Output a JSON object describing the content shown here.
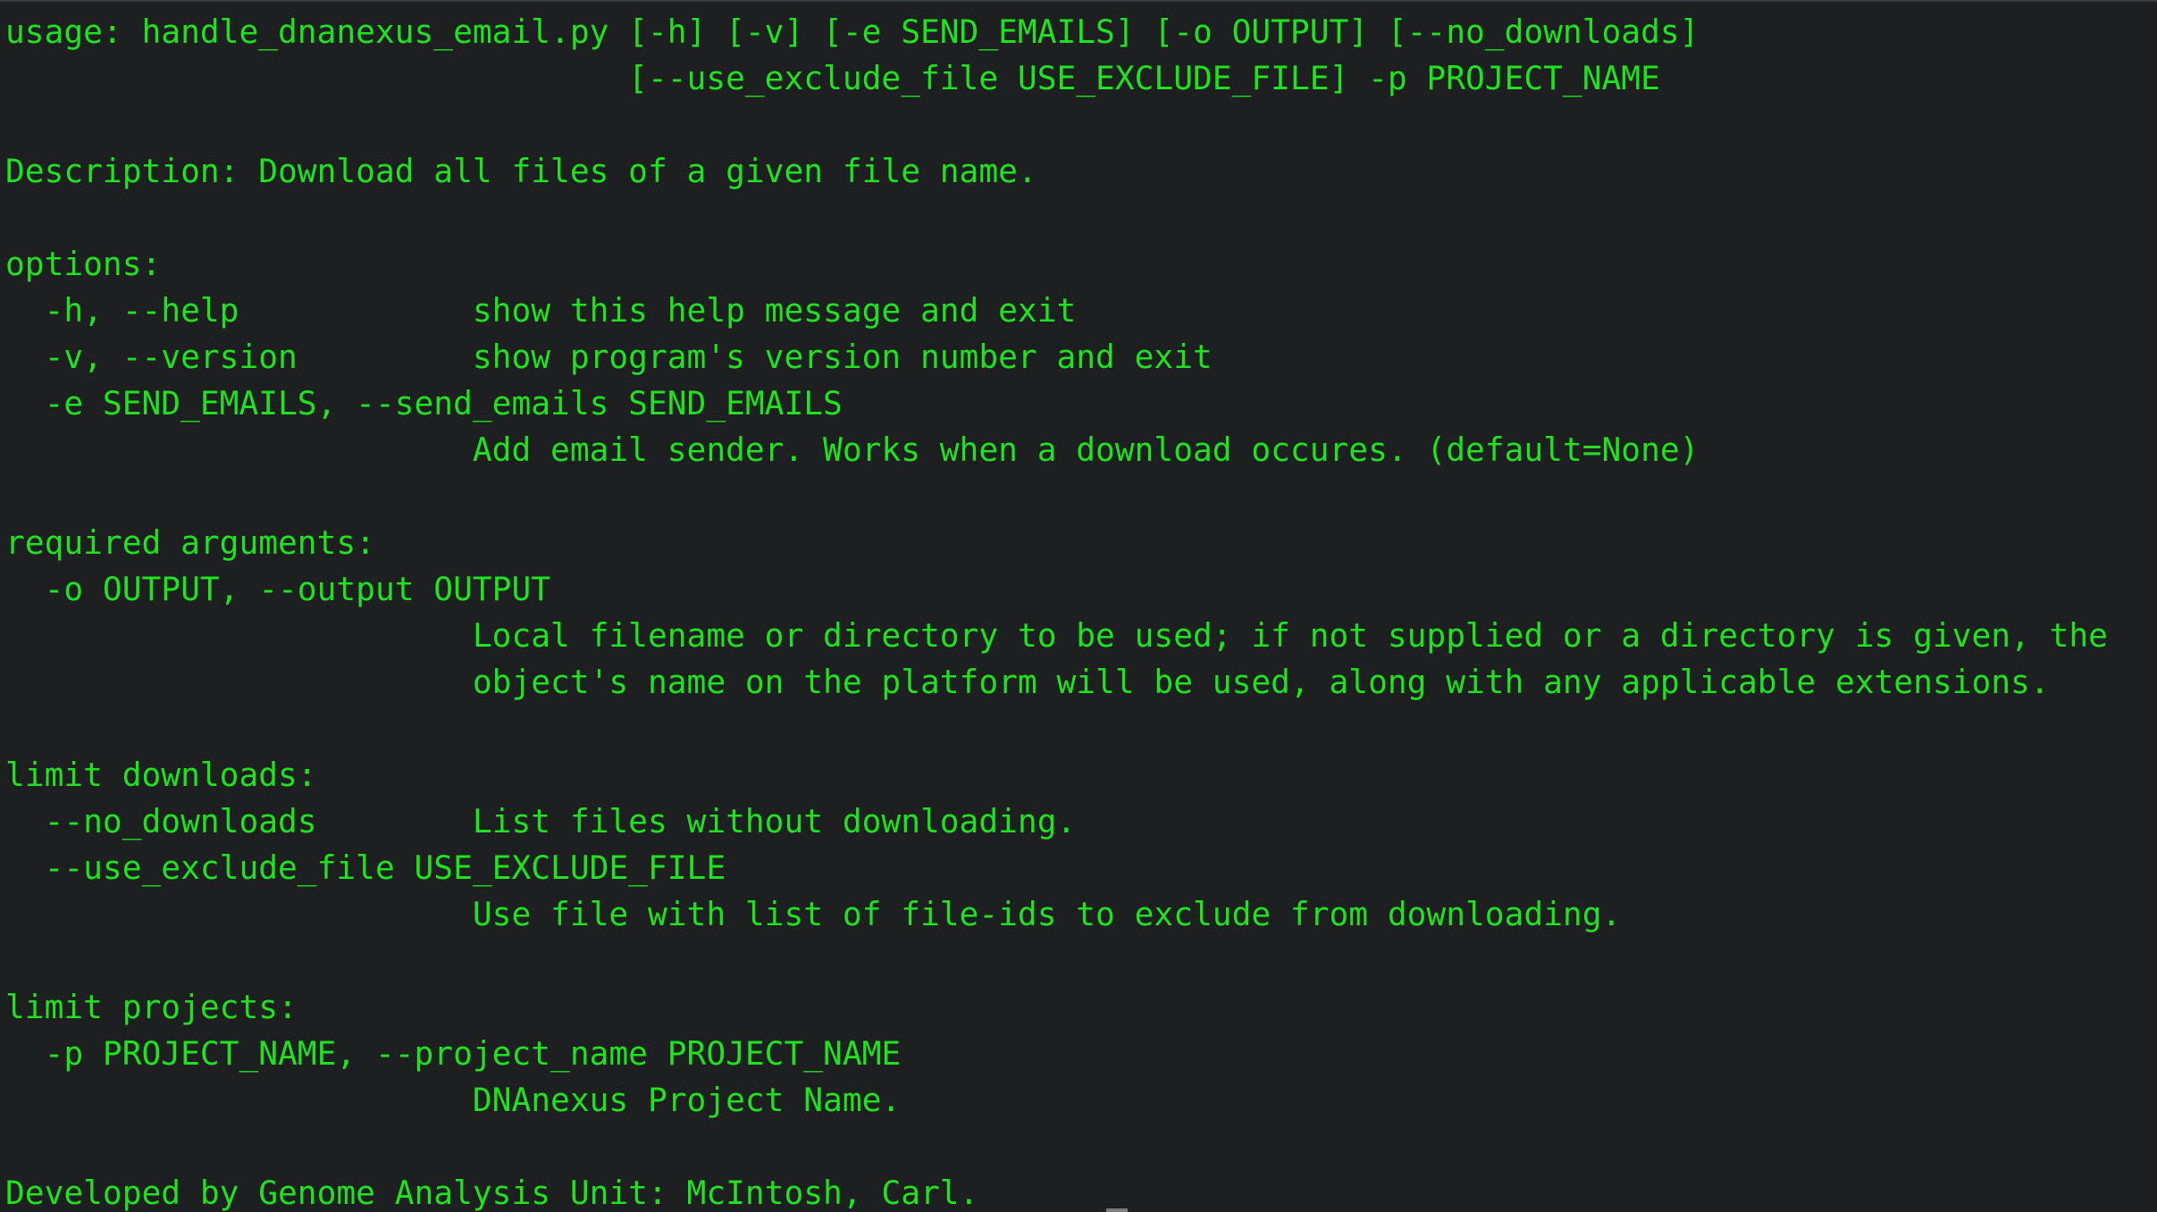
{
  "terminal": {
    "lines": [
      "usage: handle_dnanexus_email.py [-h] [-v] [-e SEND_EMAILS] [-o OUTPUT] [--no_downloads]",
      "                                [--use_exclude_file USE_EXCLUDE_FILE] -p PROJECT_NAME",
      "",
      "Description: Download all files of a given file name.",
      "",
      "options:",
      "  -h, --help            show this help message and exit",
      "  -v, --version         show program's version number and exit",
      "  -e SEND_EMAILS, --send_emails SEND_EMAILS",
      "                        Add email sender. Works when a download occures. (default=None)",
      "",
      "required arguments:",
      "  -o OUTPUT, --output OUTPUT",
      "                        Local filename or directory to be used; if not supplied or a directory is given, the",
      "                        object's name on the platform will be used, along with any applicable extensions.",
      "",
      "limit downloads:",
      "  --no_downloads        List files without downloading.",
      "  --use_exclude_file USE_EXCLUDE_FILE",
      "                        Use file with list of file-ids to exclude from downloading.",
      "",
      "limit projects:",
      "  -p PROJECT_NAME, --project_name PROJECT_NAME",
      "                        DNAnexus Project Name.",
      "",
      "Developed by Genome Analysis Unit: McIntosh, Carl."
    ]
  },
  "colors": {
    "background": "#1e1f21",
    "text": "#1fe31f"
  }
}
